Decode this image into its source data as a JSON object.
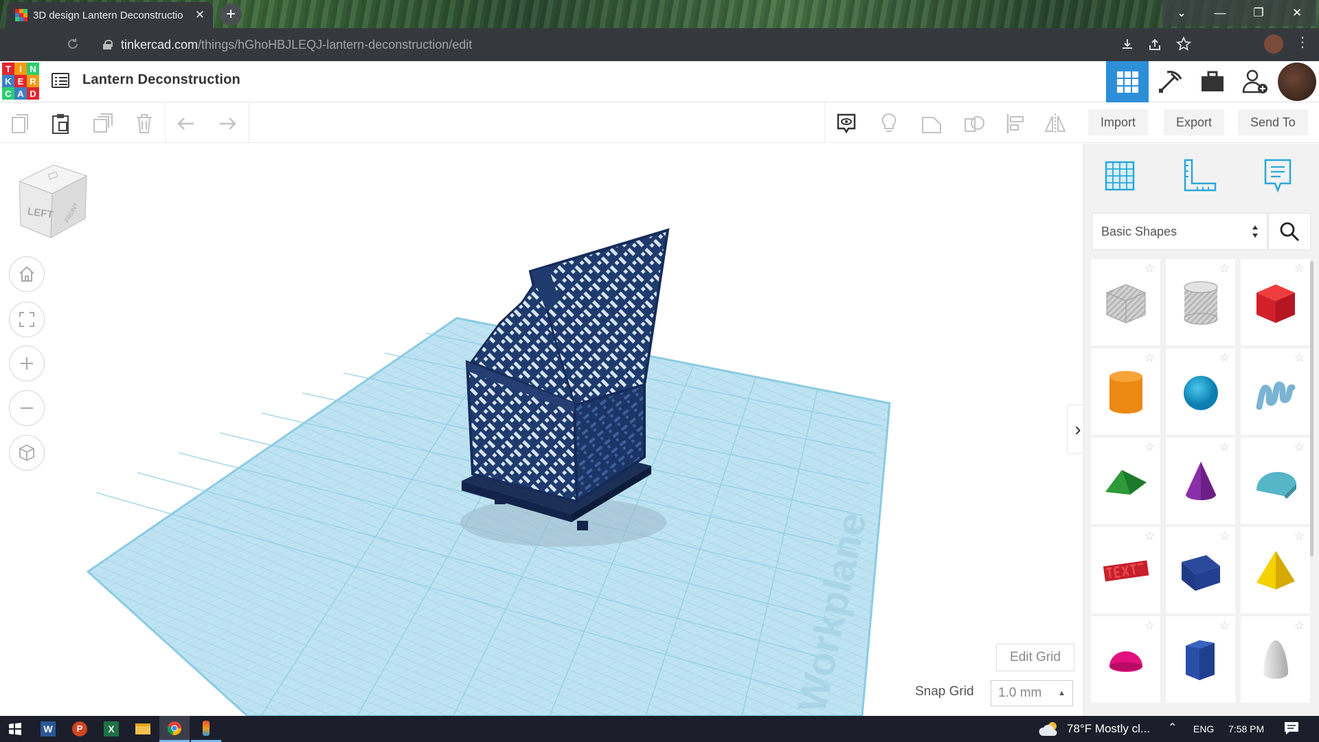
{
  "browser": {
    "tab_title": "3D design Lantern Deconstructio",
    "tab_close": "✕",
    "new_tab": "+",
    "url_host": "tinkercad.com",
    "url_path": "/things/hGhoHBJLEQJ-lantern-deconstruction/edit",
    "window_controls": [
      "⌄",
      "—",
      "❐",
      "✕"
    ]
  },
  "app": {
    "logo_letters": [
      "T",
      "I",
      "N",
      "K",
      "E",
      "R",
      "C",
      "A",
      "D"
    ],
    "logo_colors": [
      "#e3262f",
      "#f39c12",
      "#2ecc71",
      "#3a82c4",
      "#e3262f",
      "#f39c12",
      "#2ecc71",
      "#3a82c4",
      "#e3262f"
    ],
    "design_title": "Lantern Deconstruction",
    "accent": "#2d8fd8"
  },
  "toolbar": {
    "import_label": "Import",
    "export_label": "Export",
    "sendto_label": "Send To"
  },
  "viewport": {
    "viewcube_face": "LEFT",
    "viewcube_side": "FRONT",
    "workplane_text": "Workplane",
    "edit_grid_label": "Edit Grid",
    "snap_grid_label": "Snap Grid",
    "snap_grid_value": "1.0 mm"
  },
  "panel": {
    "category": "Basic Shapes",
    "shapes": [
      {
        "name": "Box (hole)",
        "icon": "box-striped-icon"
      },
      {
        "name": "Cylinder (hole)",
        "icon": "cylinder-striped-icon"
      },
      {
        "name": "Box",
        "icon": "box-red-icon"
      },
      {
        "name": "Cylinder",
        "icon": "cylinder-orange-icon"
      },
      {
        "name": "Sphere",
        "icon": "sphere-blue-icon"
      },
      {
        "name": "Scribble",
        "icon": "scribble-icon"
      },
      {
        "name": "Roof",
        "icon": "roof-green-icon"
      },
      {
        "name": "Cone",
        "icon": "cone-purple-icon"
      },
      {
        "name": "Round Roof",
        "icon": "round-roof-teal-icon"
      },
      {
        "name": "Text",
        "icon": "text-red-icon"
      },
      {
        "name": "Wedge",
        "icon": "wedge-navy-icon"
      },
      {
        "name": "Pyramid",
        "icon": "pyramid-yellow-icon"
      },
      {
        "name": "Half Sphere",
        "icon": "half-sphere-magenta-icon"
      },
      {
        "name": "Polygon",
        "icon": "polygon-blue-icon"
      },
      {
        "name": "Paraboloid",
        "icon": "paraboloid-grey-icon"
      }
    ]
  },
  "taskbar": {
    "weather": "78°F  Mostly cl...",
    "language": "ENG",
    "time": "7:58 PM"
  }
}
